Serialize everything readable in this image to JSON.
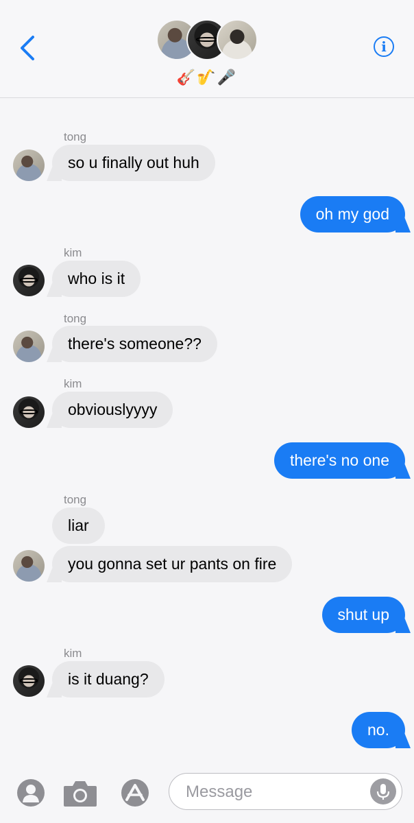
{
  "header": {
    "group_name": "🎸🎷🎤",
    "info_label": "i"
  },
  "messages": [
    {
      "sender": "tong",
      "text": "so u finally out huh"
    },
    {
      "text": "oh my god"
    },
    {
      "sender": "kim",
      "text": "who is it"
    },
    {
      "sender": "tong",
      "text": "there's someone??"
    },
    {
      "sender": "kim",
      "text": "obviouslyyyy"
    },
    {
      "text": "there's no one"
    },
    {
      "sender": "tong",
      "text": "liar"
    },
    {
      "text": "you gonna set ur pants on fire"
    },
    {
      "text": "shut up"
    },
    {
      "sender": "kim",
      "text": "is it duang?"
    },
    {
      "text": "no."
    }
  ],
  "composer": {
    "placeholder": "Message"
  },
  "colors": {
    "sent_bubble": "#1a7cf4",
    "received_bubble": "#e8e8ea",
    "accent": "#1a7cf4"
  },
  "icons": [
    "chevron-left-icon",
    "info-icon",
    "contact-icon",
    "camera-icon",
    "app-store-icon",
    "microphone-icon"
  ]
}
